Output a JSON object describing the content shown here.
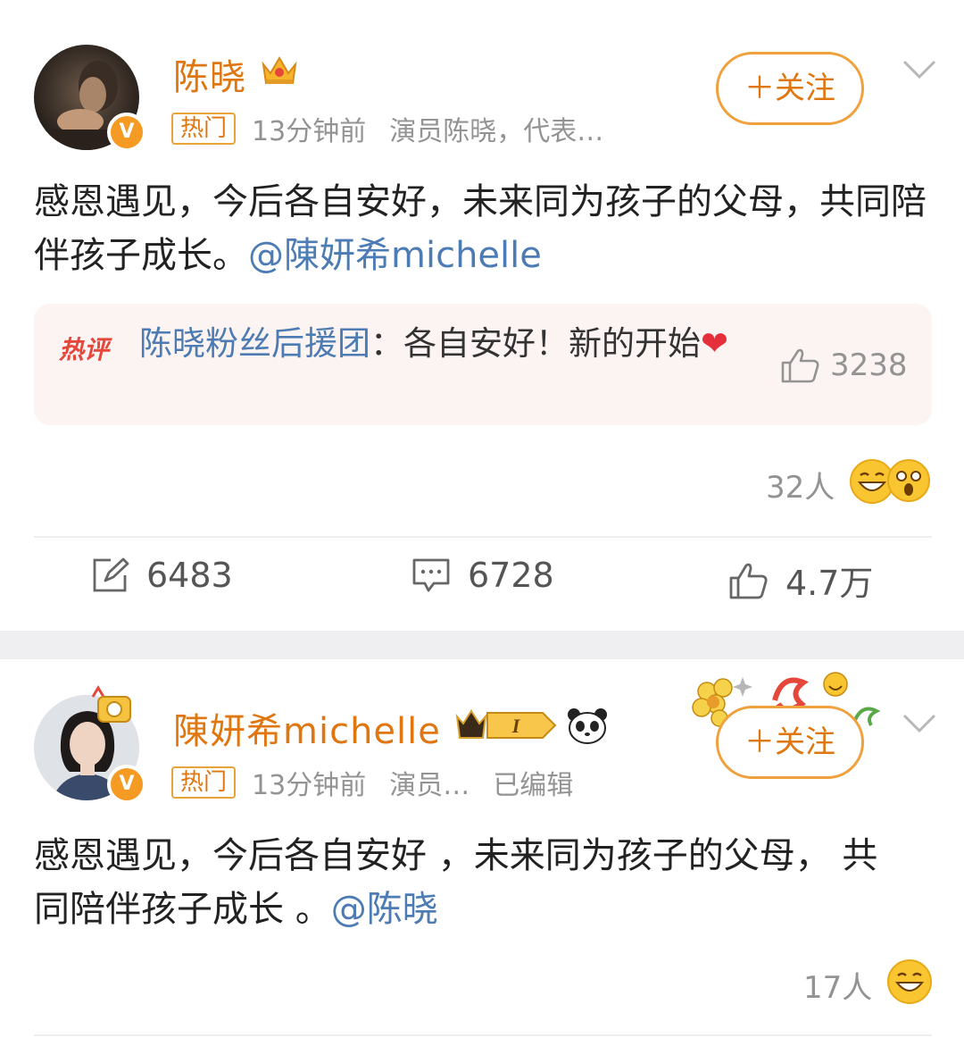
{
  "post1": {
    "author": "陈晓",
    "hot_tag": "热门",
    "time": "13分钟前",
    "bio": "演员陈晓，代表…",
    "follow_label": "＋关注",
    "content_text": "感恩遇见，今后各自安好，未来同为孩子的父母，共同陪伴孩子成长。",
    "content_mention": "@陳妍希michelle",
    "hot_comment": {
      "badge": "热评",
      "author": "陈晓粉丝后援团",
      "separator": "：",
      "text": "各自安好！新的开始",
      "heart": "❤",
      "likes": "3238"
    },
    "reactions_count": "32人",
    "reposts": "6483",
    "comments": "6728",
    "likes": "4.7万"
  },
  "post2": {
    "author": "陳妍希michelle",
    "badge_level": "I",
    "hot_tag": "热门",
    "time": "13分钟前",
    "bio": "演员…",
    "edited": "已编辑",
    "follow_label": "＋关注",
    "content_text": "感恩遇见，今后各自安好 ，未来同为孩子的父母， 共同陪伴孩子成长 。",
    "content_mention": "@陈晓",
    "reactions_count": "17人"
  },
  "colors": {
    "accent_orange": "#e0760f",
    "mention_blue": "#4c7cb3",
    "muted_gray": "#939393",
    "hot_red": "#e5473b"
  },
  "icons": [
    "crown-icon",
    "verified-v-icon",
    "chevron-down-icon",
    "thumbs-up-icon",
    "repost-icon",
    "comment-icon",
    "grin-emoji-icon",
    "surprised-emoji-icon",
    "panda-icon",
    "level-badge-icon",
    "flower-decoration-icon"
  ]
}
